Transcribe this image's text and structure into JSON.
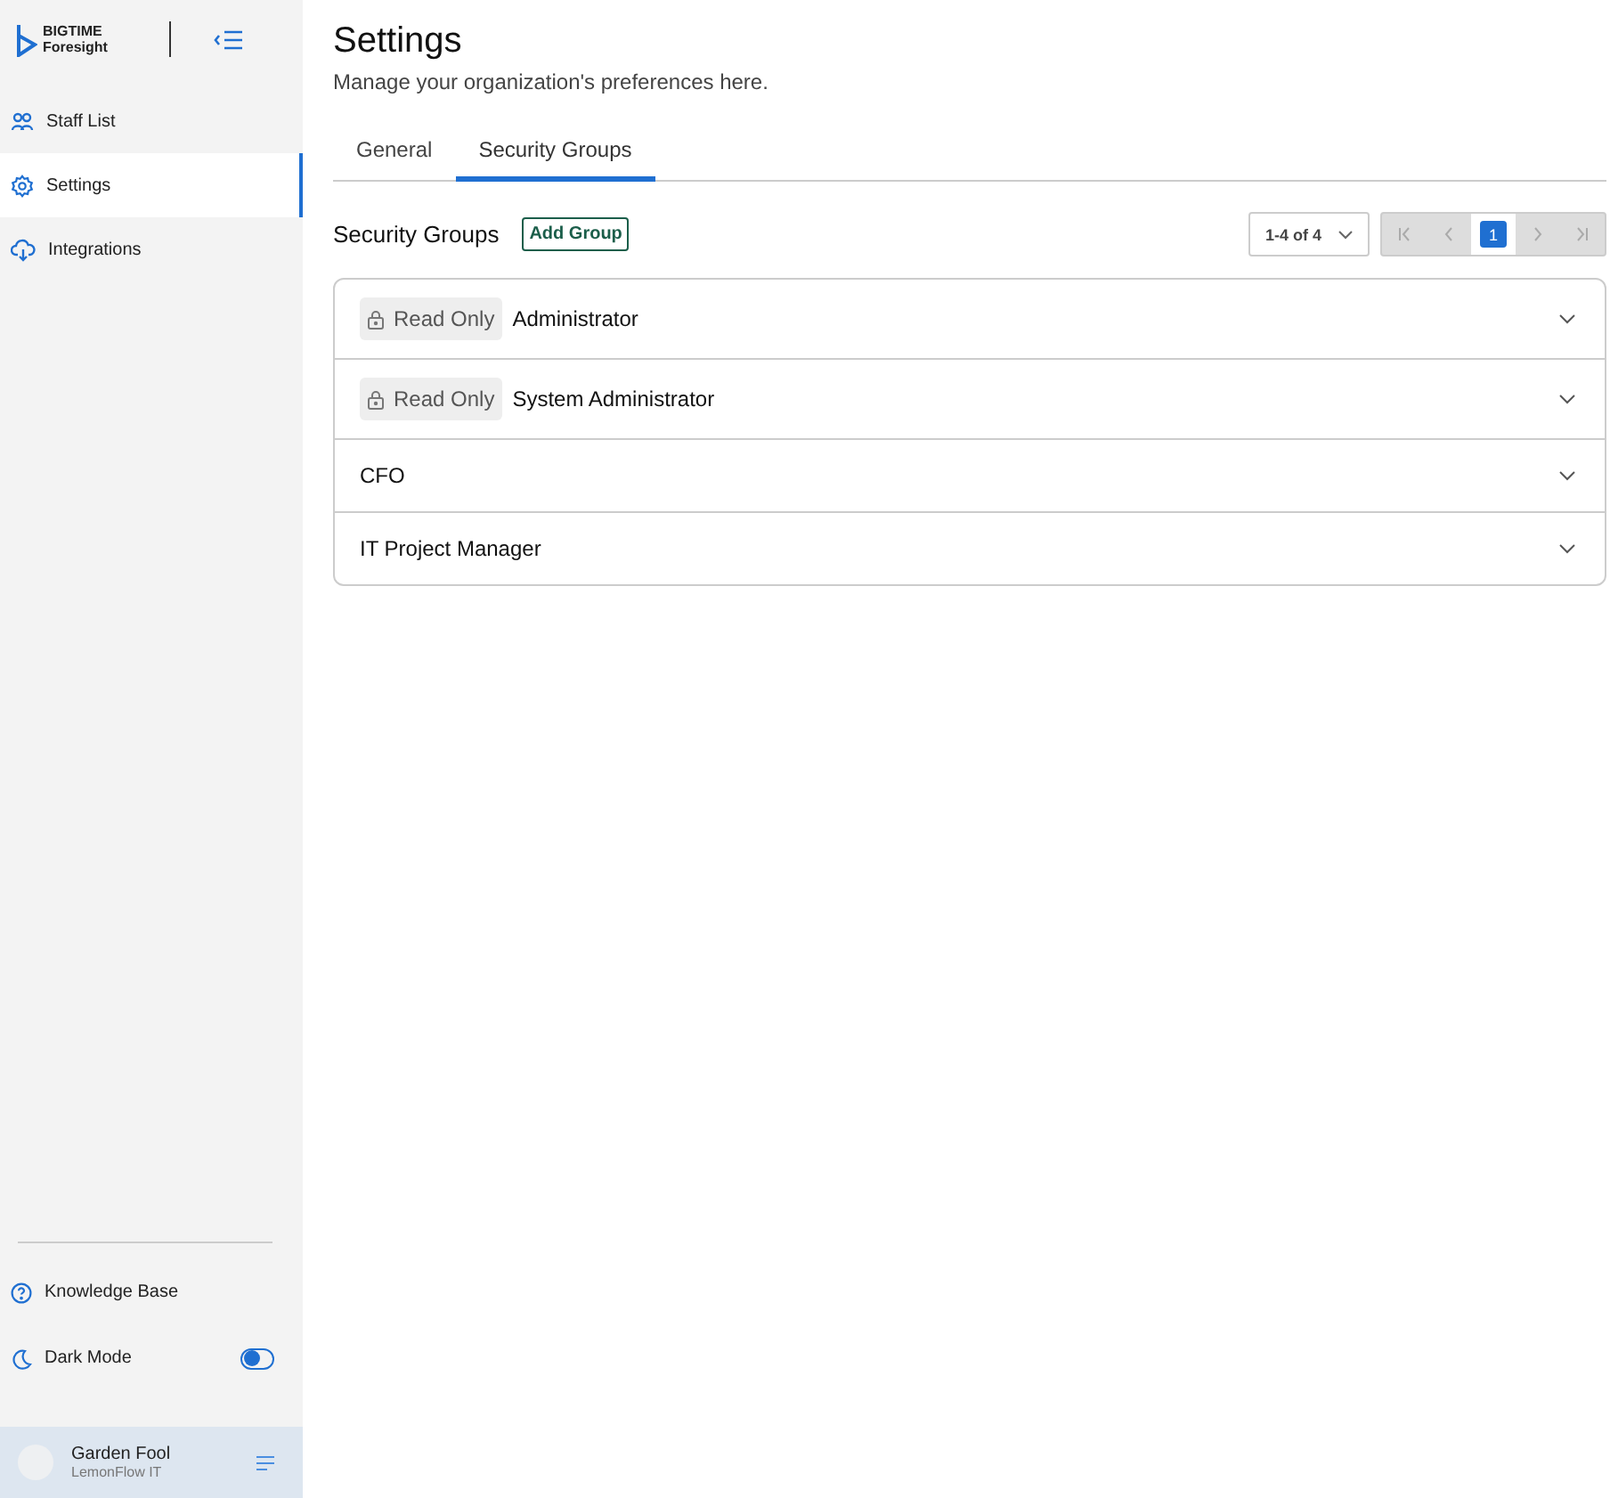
{
  "brand": {
    "line_1": "BIGTIME",
    "line_2": "Foresight"
  },
  "nav": [
    {
      "label": "Staff List",
      "selected": false
    },
    {
      "label": "Settings",
      "selected": true
    },
    {
      "label": "Integrations",
      "selected": false
    }
  ],
  "footer_nav": [
    {
      "label": "Knowledge Base",
      "kind": "link"
    },
    {
      "label": "Dark Mode",
      "kind": "toggle",
      "on": false
    }
  ],
  "user": {
    "name": "Garden Fool",
    "org": "LemonFlow IT"
  },
  "page": {
    "title": "Settings",
    "subtitle": "Manage your organization's preferences here."
  },
  "tabs": [
    {
      "label": "General",
      "selected": false
    },
    {
      "label": "Security Groups",
      "selected": true
    }
  ],
  "section": {
    "title": "Security Groups",
    "add_button": "Add Group"
  },
  "pager": {
    "range": "1-4 of 4",
    "nav": [
      {
        "kind": "first",
        "disabled": true
      },
      {
        "kind": "prev",
        "disabled": true
      },
      {
        "kind": "page",
        "label": "1",
        "selected": true
      },
      {
        "kind": "next",
        "disabled": true
      },
      {
        "kind": "last",
        "disabled": true
      }
    ]
  },
  "groups": [
    {
      "name": "Administrator",
      "badge": "Read Only",
      "expanded": false
    },
    {
      "name": "System Administrator",
      "badge": "Read Only",
      "expanded": false
    },
    {
      "name": "CFO",
      "expanded": false
    },
    {
      "name": "IT Project Manager",
      "expanded": false
    }
  ]
}
